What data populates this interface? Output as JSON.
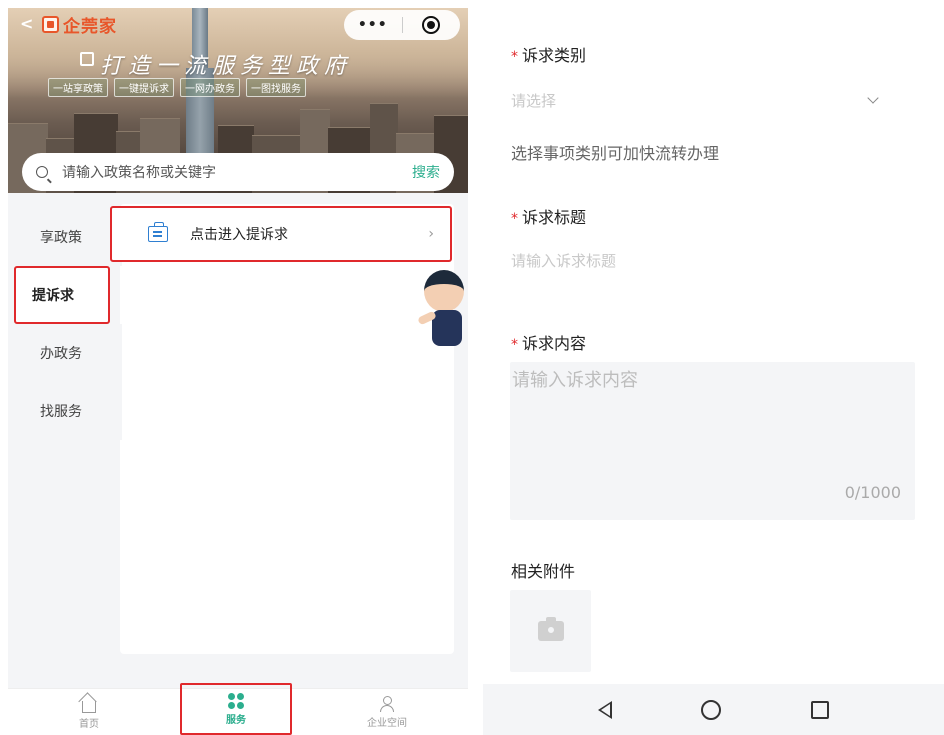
{
  "left_screen": {
    "header": {
      "back_icon": "chevron-left-icon",
      "brand_name": "企莞家",
      "capsule": {
        "more_icon": "•••",
        "target_icon": "target-icon"
      }
    },
    "hero": {
      "title": "打造一流服务型政府",
      "subtitles": [
        "一站享政策",
        "一键提诉求",
        "一网办政务",
        "一图找服务"
      ]
    },
    "search": {
      "placeholder": "请输入政策名称或关键字",
      "button_label": "搜索"
    },
    "side_nav": [
      {
        "label": "享政策",
        "active": false
      },
      {
        "label": "提诉求",
        "active": true
      },
      {
        "label": "办政务",
        "active": false
      },
      {
        "label": "找服务",
        "active": false
      }
    ],
    "entry": {
      "label": "点击进入提诉求",
      "chevron": "›"
    },
    "tabbar": [
      {
        "label": "首页",
        "icon": "home-icon"
      },
      {
        "label": "服务",
        "icon": "services-icon"
      },
      {
        "label": "企业空间",
        "icon": "user-icon"
      }
    ],
    "accent_color": "#2cae8e",
    "highlight_color": "#e0292c"
  },
  "right_screen": {
    "required_mark": "*",
    "category": {
      "label": "诉求类别",
      "placeholder": "请选择",
      "hint": "选择事项类别可加快流转办理"
    },
    "title": {
      "label": "诉求标题",
      "placeholder": "请输入诉求标题"
    },
    "content": {
      "label": "诉求内容",
      "placeholder": "请输入诉求内容",
      "counter": "0/1000"
    },
    "attachments": {
      "label": "相关附件",
      "upload_icon": "camera-icon"
    },
    "system_nav": [
      "back-icon",
      "home-icon",
      "recent-apps-icon"
    ]
  }
}
